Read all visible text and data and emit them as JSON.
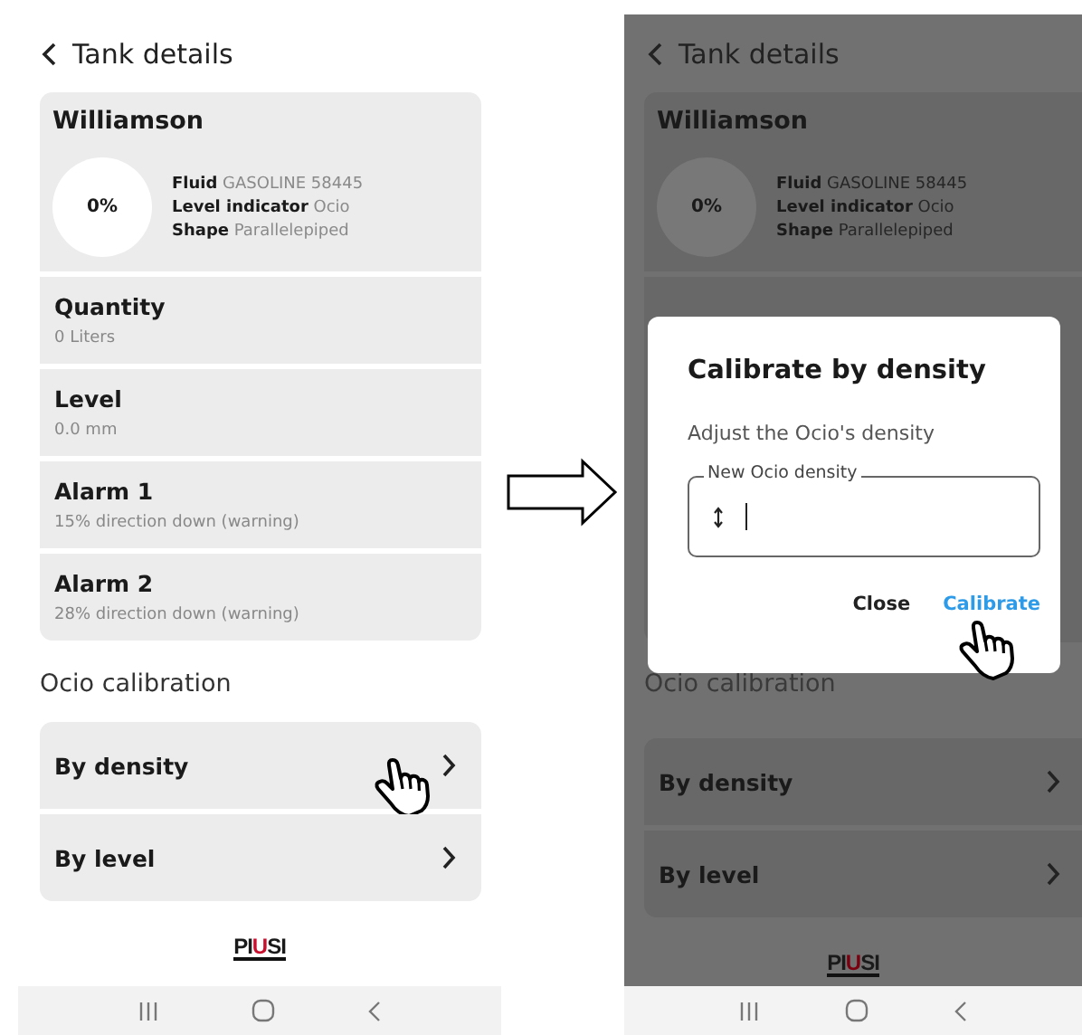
{
  "screens": [
    {
      "dimmed": false,
      "title": "Tank details",
      "tank": {
        "name": "Williamson",
        "percent": "0%",
        "info": [
          {
            "label": "Fluid",
            "value": "GASOLINE 58445"
          },
          {
            "label": "Level indicator",
            "value": "Ocio"
          },
          {
            "label": "Shape",
            "value": "Parallelepiped"
          }
        ]
      },
      "rows": [
        {
          "label": "Quantity",
          "value": "0 Liters"
        },
        {
          "label": "Level",
          "value": "0.0 mm"
        },
        {
          "label": "Alarm 1",
          "value": "15% direction down (warning)"
        },
        {
          "label": "Alarm 2",
          "value": "28% direction down (warning)"
        }
      ],
      "section": "Ocio calibration",
      "options": [
        {
          "label": "By density",
          "tapped": true
        },
        {
          "label": "By level",
          "tapped": false
        }
      ],
      "logo": [
        {
          "text": "PI",
          "accent": false
        },
        {
          "text": "U",
          "accent": true
        },
        {
          "text": "SI",
          "accent": false
        }
      ]
    },
    {
      "dimmed": true,
      "title": "Tank details",
      "tank": {
        "name": "Williamson",
        "percent": "0%",
        "info": [
          {
            "label": "Fluid",
            "value": "GASOLINE 58445"
          },
          {
            "label": "Level indicator",
            "value": "Ocio"
          },
          {
            "label": "Shape",
            "value": "Parallelepiped"
          }
        ]
      },
      "section": "Ocio calibration",
      "options": [
        {
          "label": "By density",
          "tapped": false
        },
        {
          "label": "By level",
          "tapped": false
        }
      ],
      "logo": [
        {
          "text": "PI",
          "accent": false
        },
        {
          "text": "U",
          "accent": true
        },
        {
          "text": "SI",
          "accent": false
        }
      ],
      "dialog": {
        "title": "Calibrate by density",
        "text": "Adjust the Ocio's density",
        "field_label": "New Ocio density",
        "buttons": [
          {
            "label": "Close",
            "kind": "secondary",
            "tapped": false
          },
          {
            "label": "Calibrate",
            "kind": "primary",
            "tapped": true
          }
        ]
      }
    }
  ]
}
